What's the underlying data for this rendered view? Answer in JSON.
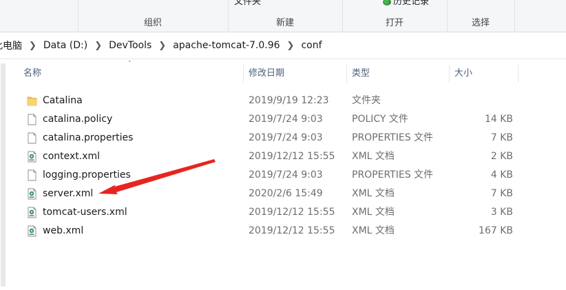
{
  "ribbon": {
    "cut_top": {
      "left": "文件夹",
      "right": "历史记录"
    },
    "groups": [
      {
        "id": "organize",
        "label": "组织"
      },
      {
        "id": "new",
        "label": "新建"
      },
      {
        "id": "open",
        "label": "打开"
      },
      {
        "id": "select",
        "label": "选择"
      }
    ]
  },
  "breadcrumb": [
    "此电脑",
    "Data (D:)",
    "DevTools",
    "apache-tomcat-7.0.96",
    "conf"
  ],
  "columns": {
    "name": "名称",
    "date": "修改日期",
    "type": "类型",
    "size": "大小"
  },
  "files": [
    {
      "name": "Catalina",
      "date": "2019/9/19 12:23",
      "type": "文件夹",
      "size": "",
      "icon": "folder-icon"
    },
    {
      "name": "catalina.policy",
      "date": "2019/7/24 9:03",
      "type": "POLICY 文件",
      "size": "14 KB",
      "icon": "file-icon"
    },
    {
      "name": "catalina.properties",
      "date": "2019/7/24 9:03",
      "type": "PROPERTIES 文件",
      "size": "7 KB",
      "icon": "file-icon"
    },
    {
      "name": "context.xml",
      "date": "2019/12/12 15:55",
      "type": "XML 文档",
      "size": "2 KB",
      "icon": "xml-file-icon"
    },
    {
      "name": "logging.properties",
      "date": "2019/7/24 9:03",
      "type": "PROPERTIES 文件",
      "size": "4 KB",
      "icon": "file-icon"
    },
    {
      "name": "server.xml",
      "date": "2020/2/6 15:49",
      "type": "XML 文档",
      "size": "7 KB",
      "icon": "xml-file-icon"
    },
    {
      "name": "tomcat-users.xml",
      "date": "2019/12/12 15:55",
      "type": "XML 文档",
      "size": "3 KB",
      "icon": "xml-file-icon"
    },
    {
      "name": "web.xml",
      "date": "2019/12/12 15:55",
      "type": "XML 文档",
      "size": "167 KB",
      "icon": "xml-file-icon"
    }
  ],
  "colors": {
    "annotation_arrow": "#e8241f",
    "folder": "#f0c54e",
    "header_text": "#4c607a"
  }
}
